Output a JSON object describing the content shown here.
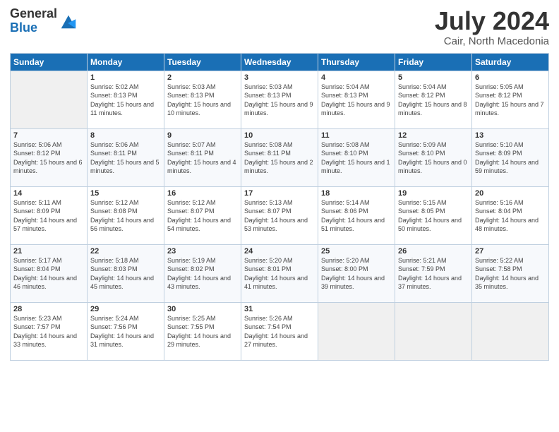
{
  "logo": {
    "general": "General",
    "blue": "Blue"
  },
  "title": "July 2024",
  "location": "Cair, North Macedonia",
  "days_of_week": [
    "Sunday",
    "Monday",
    "Tuesday",
    "Wednesday",
    "Thursday",
    "Friday",
    "Saturday"
  ],
  "weeks": [
    [
      {
        "day": "",
        "sunrise": "",
        "sunset": "",
        "daylight": "",
        "empty": true
      },
      {
        "day": "1",
        "sunrise": "Sunrise: 5:02 AM",
        "sunset": "Sunset: 8:13 PM",
        "daylight": "Daylight: 15 hours and 11 minutes.",
        "empty": false
      },
      {
        "day": "2",
        "sunrise": "Sunrise: 5:03 AM",
        "sunset": "Sunset: 8:13 PM",
        "daylight": "Daylight: 15 hours and 10 minutes.",
        "empty": false
      },
      {
        "day": "3",
        "sunrise": "Sunrise: 5:03 AM",
        "sunset": "Sunset: 8:13 PM",
        "daylight": "Daylight: 15 hours and 9 minutes.",
        "empty": false
      },
      {
        "day": "4",
        "sunrise": "Sunrise: 5:04 AM",
        "sunset": "Sunset: 8:13 PM",
        "daylight": "Daylight: 15 hours and 9 minutes.",
        "empty": false
      },
      {
        "day": "5",
        "sunrise": "Sunrise: 5:04 AM",
        "sunset": "Sunset: 8:12 PM",
        "daylight": "Daylight: 15 hours and 8 minutes.",
        "empty": false
      },
      {
        "day": "6",
        "sunrise": "Sunrise: 5:05 AM",
        "sunset": "Sunset: 8:12 PM",
        "daylight": "Daylight: 15 hours and 7 minutes.",
        "empty": false
      }
    ],
    [
      {
        "day": "7",
        "sunrise": "Sunrise: 5:06 AM",
        "sunset": "Sunset: 8:12 PM",
        "daylight": "Daylight: 15 hours and 6 minutes.",
        "empty": false
      },
      {
        "day": "8",
        "sunrise": "Sunrise: 5:06 AM",
        "sunset": "Sunset: 8:11 PM",
        "daylight": "Daylight: 15 hours and 5 minutes.",
        "empty": false
      },
      {
        "day": "9",
        "sunrise": "Sunrise: 5:07 AM",
        "sunset": "Sunset: 8:11 PM",
        "daylight": "Daylight: 15 hours and 4 minutes.",
        "empty": false
      },
      {
        "day": "10",
        "sunrise": "Sunrise: 5:08 AM",
        "sunset": "Sunset: 8:11 PM",
        "daylight": "Daylight: 15 hours and 2 minutes.",
        "empty": false
      },
      {
        "day": "11",
        "sunrise": "Sunrise: 5:08 AM",
        "sunset": "Sunset: 8:10 PM",
        "daylight": "Daylight: 15 hours and 1 minute.",
        "empty": false
      },
      {
        "day": "12",
        "sunrise": "Sunrise: 5:09 AM",
        "sunset": "Sunset: 8:10 PM",
        "daylight": "Daylight: 15 hours and 0 minutes.",
        "empty": false
      },
      {
        "day": "13",
        "sunrise": "Sunrise: 5:10 AM",
        "sunset": "Sunset: 8:09 PM",
        "daylight": "Daylight: 14 hours and 59 minutes.",
        "empty": false
      }
    ],
    [
      {
        "day": "14",
        "sunrise": "Sunrise: 5:11 AM",
        "sunset": "Sunset: 8:09 PM",
        "daylight": "Daylight: 14 hours and 57 minutes.",
        "empty": false
      },
      {
        "day": "15",
        "sunrise": "Sunrise: 5:12 AM",
        "sunset": "Sunset: 8:08 PM",
        "daylight": "Daylight: 14 hours and 56 minutes.",
        "empty": false
      },
      {
        "day": "16",
        "sunrise": "Sunrise: 5:12 AM",
        "sunset": "Sunset: 8:07 PM",
        "daylight": "Daylight: 14 hours and 54 minutes.",
        "empty": false
      },
      {
        "day": "17",
        "sunrise": "Sunrise: 5:13 AM",
        "sunset": "Sunset: 8:07 PM",
        "daylight": "Daylight: 14 hours and 53 minutes.",
        "empty": false
      },
      {
        "day": "18",
        "sunrise": "Sunrise: 5:14 AM",
        "sunset": "Sunset: 8:06 PM",
        "daylight": "Daylight: 14 hours and 51 minutes.",
        "empty": false
      },
      {
        "day": "19",
        "sunrise": "Sunrise: 5:15 AM",
        "sunset": "Sunset: 8:05 PM",
        "daylight": "Daylight: 14 hours and 50 minutes.",
        "empty": false
      },
      {
        "day": "20",
        "sunrise": "Sunrise: 5:16 AM",
        "sunset": "Sunset: 8:04 PM",
        "daylight": "Daylight: 14 hours and 48 minutes.",
        "empty": false
      }
    ],
    [
      {
        "day": "21",
        "sunrise": "Sunrise: 5:17 AM",
        "sunset": "Sunset: 8:04 PM",
        "daylight": "Daylight: 14 hours and 46 minutes.",
        "empty": false
      },
      {
        "day": "22",
        "sunrise": "Sunrise: 5:18 AM",
        "sunset": "Sunset: 8:03 PM",
        "daylight": "Daylight: 14 hours and 45 minutes.",
        "empty": false
      },
      {
        "day": "23",
        "sunrise": "Sunrise: 5:19 AM",
        "sunset": "Sunset: 8:02 PM",
        "daylight": "Daylight: 14 hours and 43 minutes.",
        "empty": false
      },
      {
        "day": "24",
        "sunrise": "Sunrise: 5:20 AM",
        "sunset": "Sunset: 8:01 PM",
        "daylight": "Daylight: 14 hours and 41 minutes.",
        "empty": false
      },
      {
        "day": "25",
        "sunrise": "Sunrise: 5:20 AM",
        "sunset": "Sunset: 8:00 PM",
        "daylight": "Daylight: 14 hours and 39 minutes.",
        "empty": false
      },
      {
        "day": "26",
        "sunrise": "Sunrise: 5:21 AM",
        "sunset": "Sunset: 7:59 PM",
        "daylight": "Daylight: 14 hours and 37 minutes.",
        "empty": false
      },
      {
        "day": "27",
        "sunrise": "Sunrise: 5:22 AM",
        "sunset": "Sunset: 7:58 PM",
        "daylight": "Daylight: 14 hours and 35 minutes.",
        "empty": false
      }
    ],
    [
      {
        "day": "28",
        "sunrise": "Sunrise: 5:23 AM",
        "sunset": "Sunset: 7:57 PM",
        "daylight": "Daylight: 14 hours and 33 minutes.",
        "empty": false
      },
      {
        "day": "29",
        "sunrise": "Sunrise: 5:24 AM",
        "sunset": "Sunset: 7:56 PM",
        "daylight": "Daylight: 14 hours and 31 minutes.",
        "empty": false
      },
      {
        "day": "30",
        "sunrise": "Sunrise: 5:25 AM",
        "sunset": "Sunset: 7:55 PM",
        "daylight": "Daylight: 14 hours and 29 minutes.",
        "empty": false
      },
      {
        "day": "31",
        "sunrise": "Sunrise: 5:26 AM",
        "sunset": "Sunset: 7:54 PM",
        "daylight": "Daylight: 14 hours and 27 minutes.",
        "empty": false
      },
      {
        "day": "",
        "sunrise": "",
        "sunset": "",
        "daylight": "",
        "empty": true
      },
      {
        "day": "",
        "sunrise": "",
        "sunset": "",
        "daylight": "",
        "empty": true
      },
      {
        "day": "",
        "sunrise": "",
        "sunset": "",
        "daylight": "",
        "empty": true
      }
    ]
  ]
}
